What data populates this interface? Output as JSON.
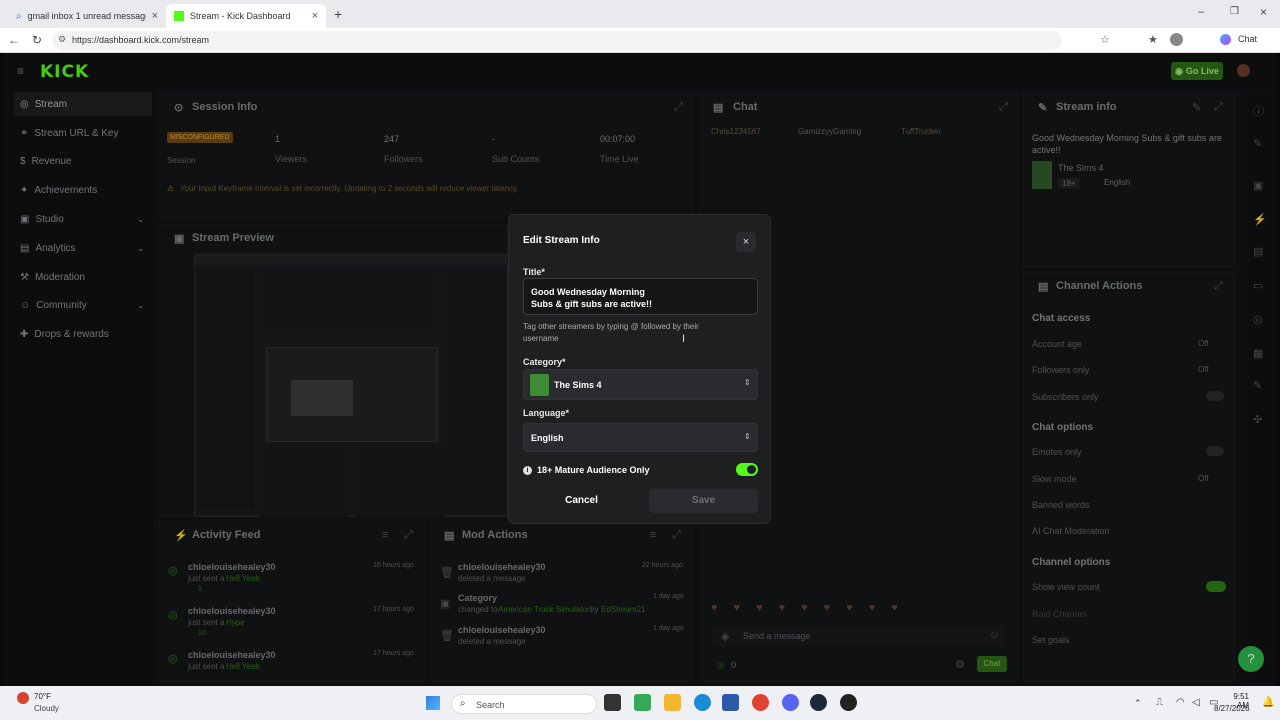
{
  "browser": {
    "tabs": [
      {
        "title": "gmail inbox 1 unread message - S",
        "active": false
      },
      {
        "title": "Stream - Kick Dashboard",
        "active": true
      }
    ],
    "url": "https://dashboard.kick.com/stream",
    "chat_label": "Chat"
  },
  "topnav": {
    "logo": "KICK",
    "go_live": "Go Live"
  },
  "sidebar": {
    "items": [
      {
        "label": "Stream",
        "active": true
      },
      {
        "label": "Stream URL & Key"
      },
      {
        "label": "Revenue"
      },
      {
        "label": "Achievements"
      },
      {
        "label": "Studio",
        "chev": true
      },
      {
        "label": "Analytics",
        "chev": true
      },
      {
        "label": "Moderation"
      },
      {
        "label": "Community",
        "chev": true
      },
      {
        "label": "Drops & rewards"
      }
    ]
  },
  "session": {
    "title": "Session Info",
    "status": "MISCONFIGURED",
    "status_label": "Session",
    "stats": [
      {
        "value": "1",
        "label": "Viewers"
      },
      {
        "value": "247",
        "label": "Followers"
      },
      {
        "value": "-",
        "label": "Sub Counts"
      },
      {
        "value": "00:07:00",
        "label": "Time Live"
      }
    ],
    "warning": "Your Input Keyframe Interval is set incorrectly. Updating to 2 seconds will reduce viewer latency."
  },
  "preview": {
    "title": "Stream Preview"
  },
  "chat": {
    "title": "Chat",
    "users": [
      "Chris1234567",
      "GamizzyyGaming",
      "TuffTrucker"
    ],
    "placeholder": "Send a message",
    "count": "0",
    "send": "Chat"
  },
  "stream_info": {
    "title": "Stream info",
    "text": "Good Wednesday Morning Subs & gift subs are active!!",
    "game": "The Sims 4",
    "tags": [
      "18+",
      "English"
    ]
  },
  "channel_actions": {
    "title": "Channel Actions",
    "sections": [
      {
        "head": "Chat access",
        "rows": [
          {
            "label": "Account age",
            "value": "Off"
          },
          {
            "label": "Followers only",
            "value": "Off"
          },
          {
            "label": "Subscribers only",
            "toggle": false
          }
        ]
      },
      {
        "head": "Chat options",
        "rows": [
          {
            "label": "Emotes only",
            "toggle": false
          },
          {
            "label": "Slow mode",
            "value": "Off"
          },
          {
            "label": "Banned words"
          },
          {
            "label": "AI Chat Moderation"
          }
        ]
      },
      {
        "head": "Channel options",
        "rows": [
          {
            "label": "Show view count",
            "toggle": true
          },
          {
            "label": "Raid Channel"
          },
          {
            "label": "Set goals"
          }
        ]
      }
    ]
  },
  "activity": {
    "title": "Activity Feed",
    "items": [
      {
        "user": "chloelouisehealey30",
        "time": "16 hours ago",
        "action": "just sent a",
        "gift": "Hell Yeah",
        "count": "1"
      },
      {
        "user": "chloelouisehealey30",
        "time": "17 hours ago",
        "action": "just sent a",
        "gift": "Hype",
        "count": "10"
      },
      {
        "user": "chloelouisehealey30",
        "time": "17 hours ago",
        "action": "just sent a",
        "gift": "Hell Yeah",
        "count": ""
      }
    ]
  },
  "mod": {
    "title": "Mod Actions",
    "items": [
      {
        "user": "chloelouisehealey30",
        "time": "22 hours ago",
        "desc": "deleted a message"
      },
      {
        "user": "Category",
        "time": "1 day ago",
        "desc": "changed to",
        "target": "American Truck Simulator",
        "by": "by",
        "actor": "EdStream21"
      },
      {
        "user": "chloelouisehealey30",
        "time": "1 day ago",
        "desc": "deleted a message"
      }
    ]
  },
  "modal": {
    "title": "Edit Stream Info",
    "title_label": "Title*",
    "title_value_1": "Good Wednesday Morning",
    "title_value_2": "Subs & gift subs are active!!",
    "hint": "Tag other streamers by typing @ followed by their username",
    "category_label": "Category*",
    "category_value": "The Sims 4",
    "language_label": "Language*",
    "language_value": "English",
    "mature_label": "18+ Mature Audience Only",
    "mature_on": true,
    "cancel": "Cancel",
    "save": "Save"
  },
  "taskbar": {
    "temp": "70°F",
    "weather": "Cloudy",
    "search": "Search",
    "time": "9:51 AM",
    "date": "8/27/2026"
  }
}
